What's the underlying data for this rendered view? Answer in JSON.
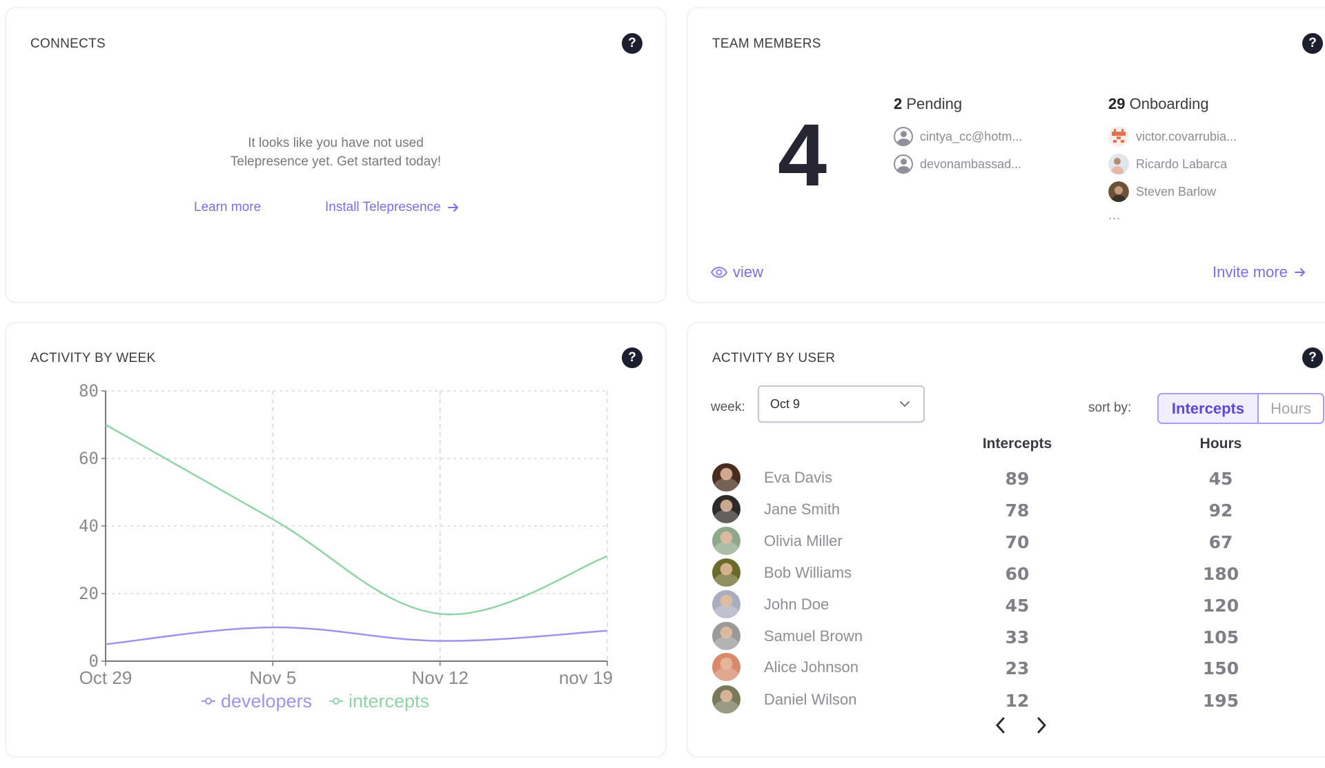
{
  "connects": {
    "title": "CONNECTS",
    "message_line1": "It looks like you have not used",
    "message_line2": "Telepresence yet. Get started today!",
    "learn_more": "Learn more",
    "install": "Install Telepresence"
  },
  "team": {
    "title": "TEAM MEMBERS",
    "count": "4",
    "pending": {
      "count": "2",
      "label": "Pending",
      "members": [
        "cintya_cc@hotm...",
        "devonambassad..."
      ]
    },
    "onboarding": {
      "count": "29",
      "label": "Onboarding",
      "members": [
        {
          "name": "victor.covarrubia...",
          "avatar_color": "#e4714f"
        },
        {
          "name": "Ricardo Labarca",
          "avatar_color": "#c9a99a"
        },
        {
          "name": "Steven Barlow",
          "avatar_color": "#5a4632"
        }
      ],
      "more": "..."
    },
    "view": "view",
    "invite": "Invite more"
  },
  "activity_week": {
    "title": "ACTIVITY BY WEEK"
  },
  "chart_data": {
    "type": "line",
    "title": "ACTIVITY BY WEEK",
    "categories": [
      "Oct 29",
      "Nov 5",
      "Nov 12",
      "nov 19"
    ],
    "series": [
      {
        "name": "developers",
        "color": "#9c94ec",
        "values": [
          5,
          10,
          6,
          9
        ]
      },
      {
        "name": "intercepts",
        "color": "#8fd4a6",
        "values": [
          70,
          42,
          14,
          31
        ]
      }
    ],
    "yticks": [
      0,
      20,
      40,
      60,
      80
    ],
    "ylim": [
      0,
      80
    ],
    "xlabel": "",
    "ylabel": "",
    "grid": true,
    "legend": "bottom"
  },
  "activity_user": {
    "title": "ACTIVITY BY USER",
    "week_label": "week:",
    "week_value": "Oct 9",
    "sort_label": "sort by:",
    "sort_options": [
      "Intercepts",
      "Hours"
    ],
    "sort_active": "Intercepts",
    "columns": [
      "Intercepts",
      "Hours"
    ],
    "rows": [
      {
        "name": "Eva Davis",
        "intercepts": "89",
        "hours": "45",
        "avatar_color": "#4a2c1e"
      },
      {
        "name": "Jane Smith",
        "intercepts": "78",
        "hours": "92",
        "avatar_color": "#2e2a2a"
      },
      {
        "name": "Olivia Miller",
        "intercepts": "70",
        "hours": "67",
        "avatar_color": "#8fa78a"
      },
      {
        "name": "Bob Williams",
        "intercepts": "60",
        "hours": "180",
        "avatar_color": "#6b6a2a"
      },
      {
        "name": "John Doe",
        "intercepts": "45",
        "hours": "120",
        "avatar_color": "#a8aebd"
      },
      {
        "name": "Samuel Brown",
        "intercepts": "33",
        "hours": "105",
        "avatar_color": "#9a9a9a"
      },
      {
        "name": "Alice Johnson",
        "intercepts": "23",
        "hours": "150",
        "avatar_color": "#d98a6a"
      },
      {
        "name": "Daniel Wilson",
        "intercepts": "12",
        "hours": "195",
        "avatar_color": "#7a7a5a"
      }
    ]
  }
}
